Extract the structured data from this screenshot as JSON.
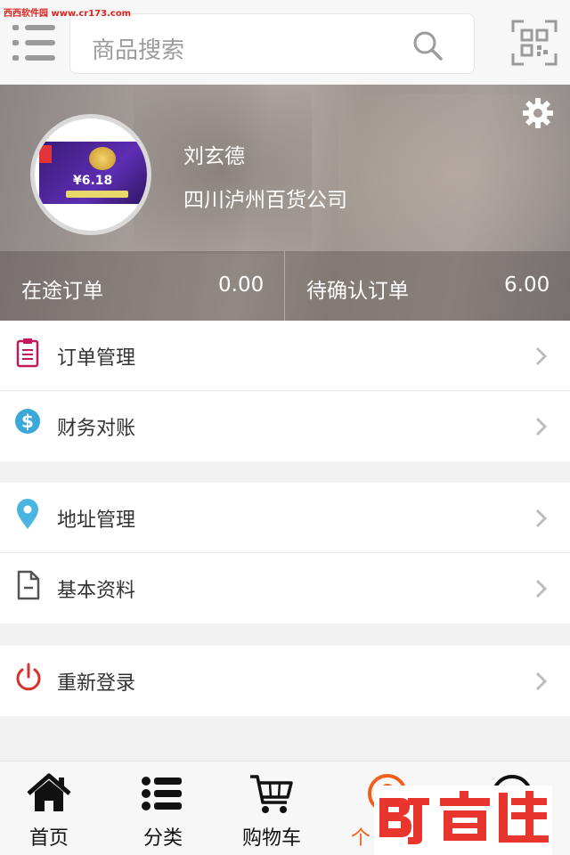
{
  "watermark_top": "西西软件园 www.cr173.com",
  "search": {
    "placeholder": "商品搜索"
  },
  "profile": {
    "name": "刘玄德",
    "company": "四川泸州百货公司",
    "avatar_promo_text": "¥6.18"
  },
  "stats": [
    {
      "label": "在途订单",
      "value": "0.00"
    },
    {
      "label": "待确认订单",
      "value": "6.00"
    }
  ],
  "menu_groups": [
    [
      {
        "label": "订单管理",
        "icon": "clipboard-icon",
        "color": "#c2185b"
      },
      {
        "label": "财务对账",
        "icon": "dollar-icon",
        "color": "#3aa8d8"
      }
    ],
    [
      {
        "label": "地址管理",
        "icon": "location-pin-icon",
        "color": "#4ab5e0"
      },
      {
        "label": "基本资料",
        "icon": "document-icon",
        "color": "#555555"
      }
    ],
    [
      {
        "label": "重新登录",
        "icon": "power-icon",
        "color": "#d9302c"
      }
    ]
  ],
  "bottom_nav": [
    {
      "label": "首页",
      "icon": "home-icon"
    },
    {
      "label": "分类",
      "icon": "list-icon"
    },
    {
      "label": "购物车",
      "icon": "cart-icon"
    },
    {
      "label": "个",
      "icon": "user-icon",
      "active": true
    },
    {
      "label": "",
      "icon": "more-icon"
    }
  ],
  "colors": {
    "accent": "#f0601c",
    "banner": "#a39c98"
  }
}
